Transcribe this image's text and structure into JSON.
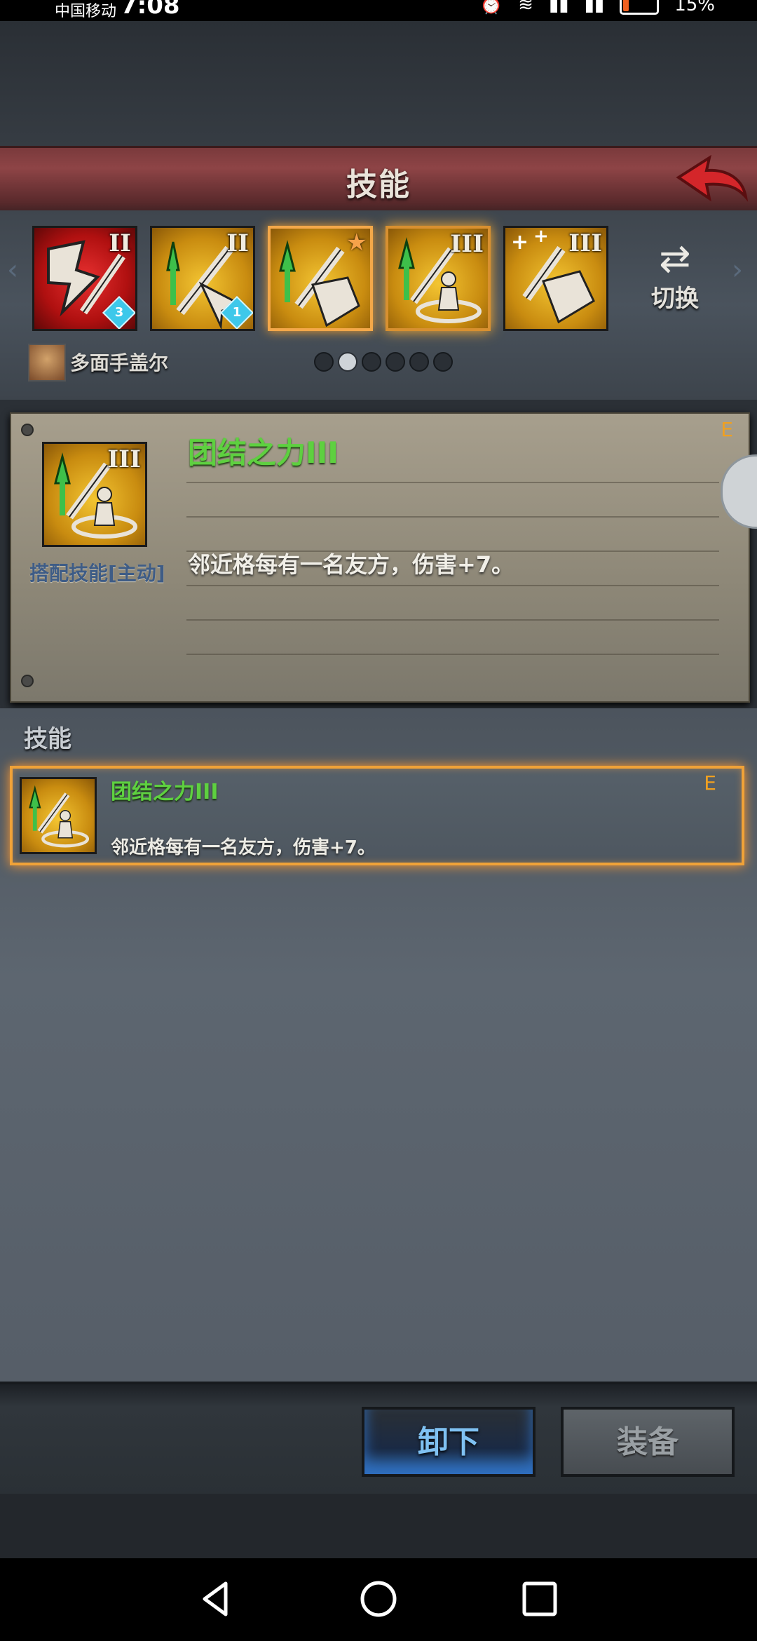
{
  "status_bar": {
    "carrier": "中国移动",
    "time": "7:08",
    "battery": "15%"
  },
  "header": {
    "title": "技能"
  },
  "skills_strip": {
    "skills": [
      {
        "roman": "II",
        "gem": "3",
        "color": "red"
      },
      {
        "roman": "II",
        "gem": "1",
        "color": "gold"
      },
      {
        "roman": "",
        "star": true,
        "color": "gold",
        "selected": true
      },
      {
        "roman": "III",
        "color": "gold",
        "selected": true
      },
      {
        "roman": "III",
        "color": "gold"
      }
    ],
    "switch_label": "切换",
    "hero_name": "多面手盖尔",
    "page_count": 6,
    "current_page": 2
  },
  "detail": {
    "roman": "III",
    "category": "搭配技能[主动]",
    "name": "团结之力III",
    "description": "邻近格每有一名友方，伤害+7。",
    "grade": "E"
  },
  "list": {
    "section_title": "技能",
    "items": [
      {
        "name": "团结之力III",
        "description": "邻近格每有一名友方，伤害+7。",
        "grade": "E"
      }
    ]
  },
  "buttons": {
    "unload": "卸下",
    "equip": "装备"
  },
  "colors": {
    "accent_orange": "#f0a238",
    "skill_green": "#5ed040",
    "header_red": "#8e4446"
  }
}
